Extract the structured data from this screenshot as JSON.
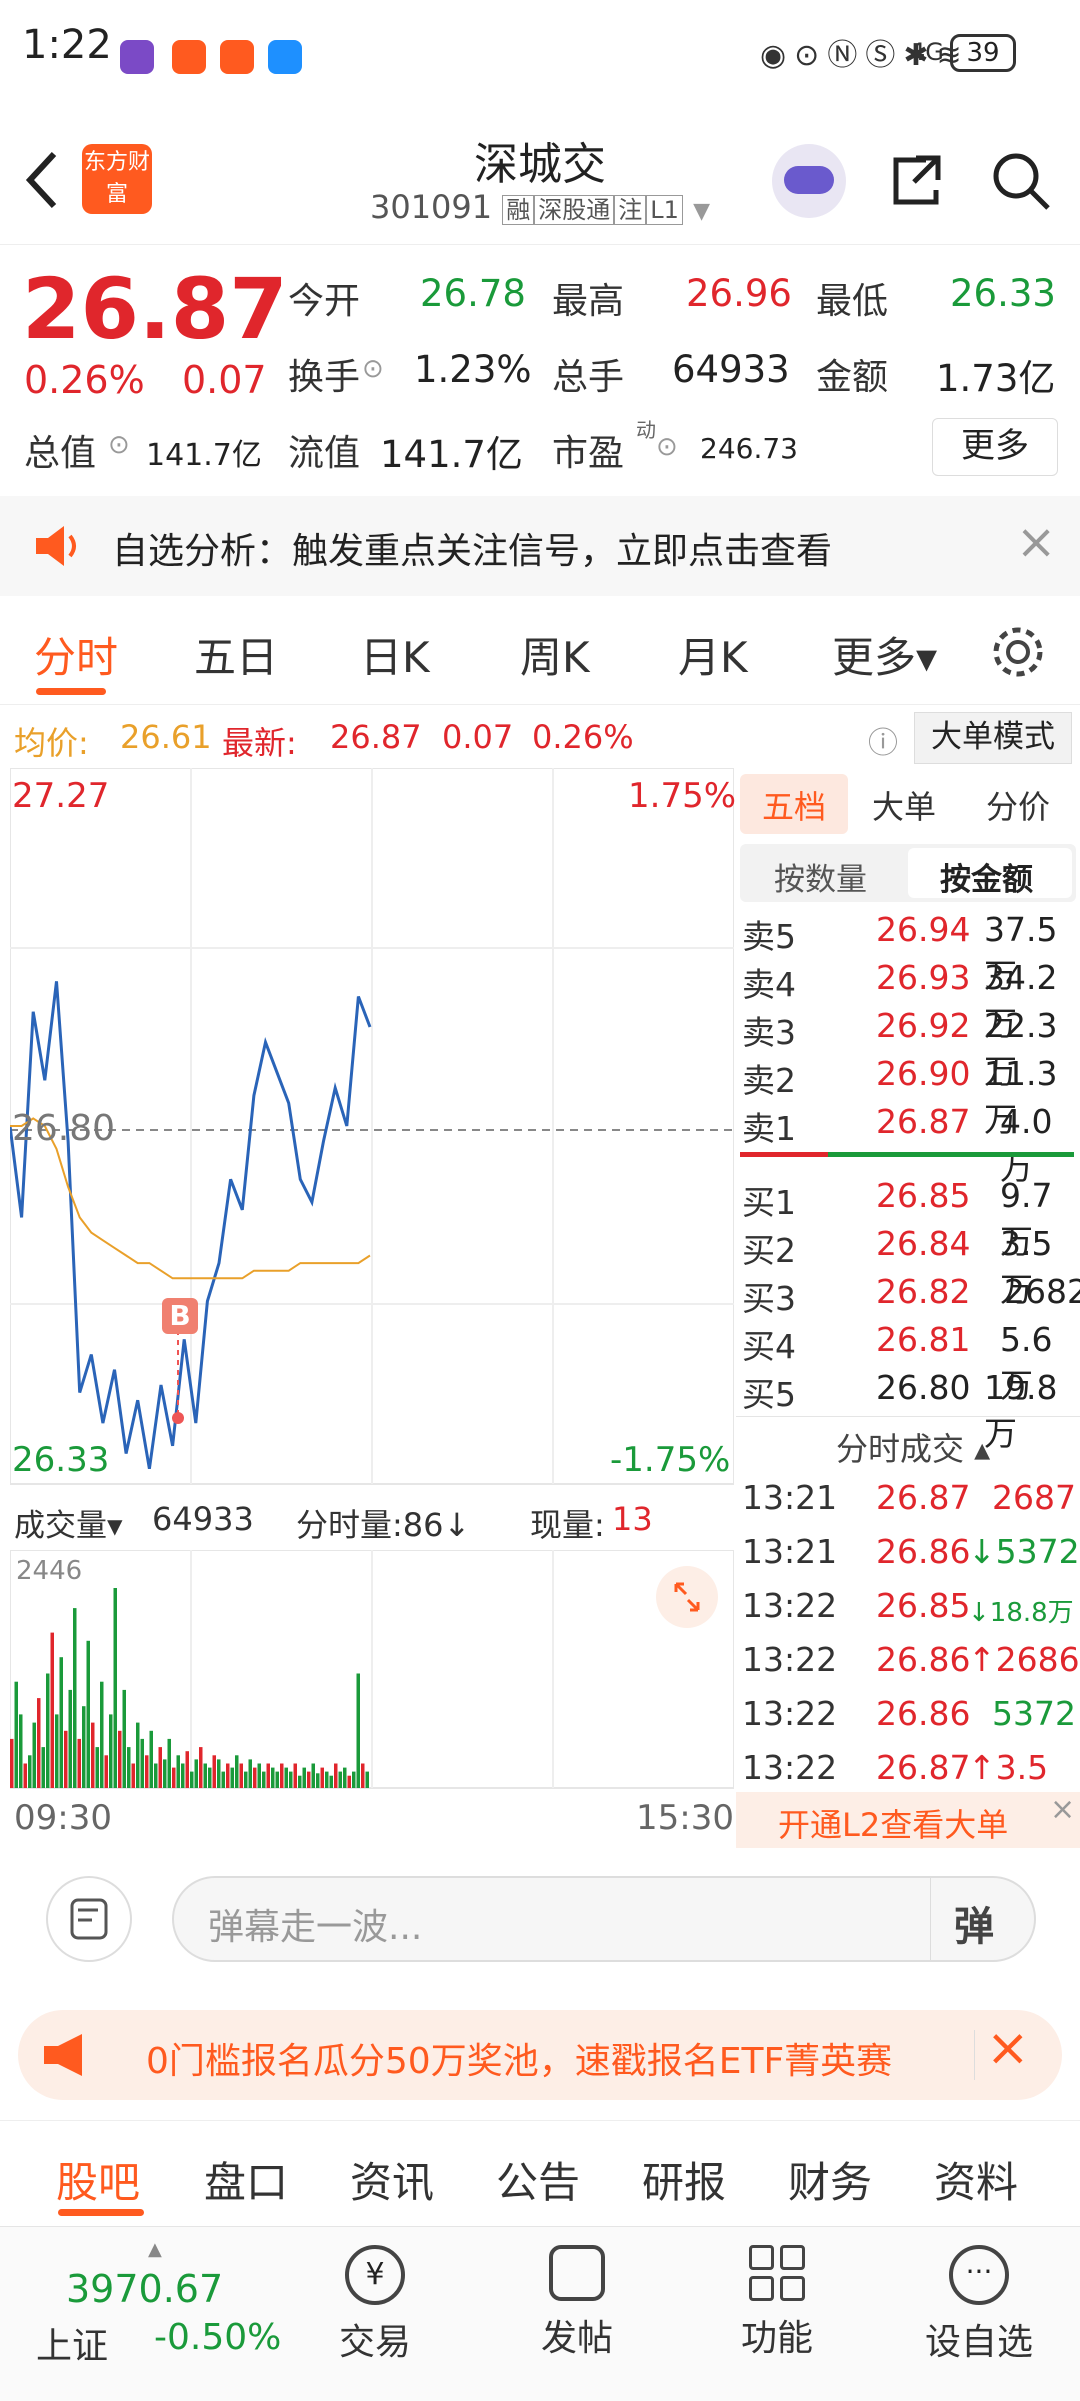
{
  "status_bar": {
    "time": "1:22",
    "battery": "39",
    "signal": "4G"
  },
  "header": {
    "back_icon": "chevron-left-icon",
    "logo_text": "东方财富",
    "stock_name": "深城交",
    "stock_code": "301091",
    "tags": [
      "融",
      "深股通",
      "注",
      "L1"
    ]
  },
  "quote": {
    "price": "26.87",
    "change_pct": "0.26%",
    "change": "0.07",
    "open_label": "今开",
    "open": "26.78",
    "high_label": "最高",
    "high": "26.96",
    "low_label": "最低",
    "low": "26.33",
    "turnover_label": "换手",
    "turnover": "1.23%",
    "volume_label": "总手",
    "volume": "64933",
    "amount_label": "金额",
    "amount": "1.73亿",
    "mktcap_label": "总值",
    "mktcap": "141.7亿",
    "float_label": "流值",
    "float": "141.7亿",
    "pe_label": "市盈",
    "pe_sup": "动",
    "pe": "246.73",
    "more_label": "更多"
  },
  "notice": {
    "text": "自选分析：触发重点关注信号，立即点击查看"
  },
  "chart_tabs": [
    {
      "label": "分时"
    },
    {
      "label": "五日"
    },
    {
      "label": "日K"
    },
    {
      "label": "周K"
    },
    {
      "label": "月K"
    },
    {
      "label": "更多▾"
    }
  ],
  "info_line": {
    "avg_label": "均价:",
    "avg": "26.61",
    "latest_label": "最新:",
    "latest": "26.87",
    "chg": "0.07",
    "pct": "0.26%",
    "mode_label": "大单模式"
  },
  "chart_labels": {
    "top_price": "27.27",
    "top_pct": "1.75%",
    "mid_price": "26.80",
    "bottom_price": "26.33",
    "bottom_pct": "-1.75%",
    "marker": "B"
  },
  "chart_data": {
    "type": "line",
    "ylim": [
      26.33,
      27.27
    ],
    "series": [
      {
        "values": [
          26.8,
          26.68,
          26.95,
          26.86,
          26.99,
          26.78,
          26.45,
          26.5,
          26.41,
          26.48,
          26.37,
          26.44,
          26.35,
          26.46,
          26.38,
          26.52,
          26.41,
          26.57,
          26.62,
          26.73,
          26.69,
          26.84,
          26.91,
          26.87,
          26.83,
          26.73,
          26.7,
          26.78,
          26.85,
          26.8,
          26.97,
          26.93
        ]
      },
      {
        "values": [
          26.8,
          26.8,
          26.81,
          26.8,
          26.77,
          26.72,
          26.68,
          26.66,
          26.65,
          26.64,
          26.63,
          26.62,
          26.62,
          26.61,
          26.6,
          26.6,
          26.6,
          26.6,
          26.6,
          26.6,
          26.6,
          26.61,
          26.61,
          26.61,
          26.61,
          26.62,
          26.62,
          26.62,
          26.62,
          26.62,
          26.62,
          26.63
        ]
      }
    ]
  },
  "volume_header": {
    "label": "成交量▾",
    "volume": "64933",
    "period_label": "分时量:86↓",
    "now_label": "现量:",
    "now": "13"
  },
  "volume_max": "2446",
  "volume_data": [
    600,
    1300,
    900,
    300,
    400,
    800,
    1100,
    500,
    1400,
    1900,
    900,
    1600,
    700,
    1200,
    2200,
    600,
    1000,
    1800,
    800,
    500,
    1300,
    400,
    900,
    2446,
    700,
    1200,
    500,
    300,
    800,
    600,
    400,
    700,
    300,
    500,
    350,
    600,
    250,
    400,
    300,
    450,
    200,
    350,
    500,
    300,
    250,
    400,
    350,
    200,
    300,
    250,
    400,
    300,
    200,
    350,
    250,
    300,
    200,
    300,
    250,
    200,
    300,
    250,
    200,
    300,
    150,
    250,
    200,
    300,
    180,
    250,
    200,
    150,
    300,
    200,
    250,
    150,
    200,
    1400,
    300,
    200
  ],
  "time_axis": {
    "start": "09:30",
    "end": "15:30"
  },
  "order_panel": {
    "tabs": [
      "五档",
      "大单",
      "分价"
    ],
    "sub_tabs": [
      "按数量",
      "按金额"
    ],
    "asks": [
      {
        "label": "卖5",
        "price": "26.94",
        "amount": "37.5万"
      },
      {
        "label": "卖4",
        "price": "26.93",
        "amount": "34.2万"
      },
      {
        "label": "卖3",
        "price": "26.92",
        "amount": "22.3万"
      },
      {
        "label": "卖2",
        "price": "26.90",
        "amount": "11.3万"
      },
      {
        "label": "卖1",
        "price": "26.87",
        "amount": "4.0万"
      }
    ],
    "bids": [
      {
        "label": "买1",
        "price": "26.85",
        "amount": "9.7万"
      },
      {
        "label": "买2",
        "price": "26.84",
        "amount": "3.5万"
      },
      {
        "label": "买3",
        "price": "26.82",
        "amount": "2682"
      },
      {
        "label": "买4",
        "price": "26.81",
        "amount": "5.6万"
      },
      {
        "label": "买5",
        "price": "26.80",
        "amount": "19.8万"
      }
    ],
    "trades_title": "分时成交 ▴",
    "trades": [
      {
        "time": "13:21",
        "price": "26.87",
        "amount": "2687"
      },
      {
        "time": "13:21",
        "price": "26.86",
        "amount": "↓5372"
      },
      {
        "time": "13:22",
        "price": "26.85",
        "amount": "↓18.8万"
      },
      {
        "time": "13:22",
        "price": "26.86",
        "amount": "↑2686"
      },
      {
        "time": "13:22",
        "price": "26.86",
        "amount": "5372"
      },
      {
        "time": "13:22",
        "price": "26.87",
        "amount": "↑3.5万"
      }
    ],
    "l2_label": "开通L2查看大单"
  },
  "danmu": {
    "placeholder": "弹幕走一波...",
    "send_label": "弹"
  },
  "promo": {
    "text": "0门槛报名瓜分50万奖池，速戳报名ETF菁英赛"
  },
  "bottom_tabs": [
    {
      "label": "股吧"
    },
    {
      "label": "盘口"
    },
    {
      "label": "资讯"
    },
    {
      "label": "公告"
    },
    {
      "label": "研报"
    },
    {
      "label": "财务"
    },
    {
      "label": "资料"
    }
  ],
  "nav": {
    "index_value": "3970.67",
    "index_name": "上证",
    "index_change": "-0.50%",
    "items": [
      {
        "label": "交易"
      },
      {
        "label": "发帖"
      },
      {
        "label": "功能"
      },
      {
        "label": "设自选"
      }
    ]
  },
  "colors": {
    "up": "#e0262c",
    "down": "#1a9a3a",
    "accent": "#ff6a00"
  }
}
